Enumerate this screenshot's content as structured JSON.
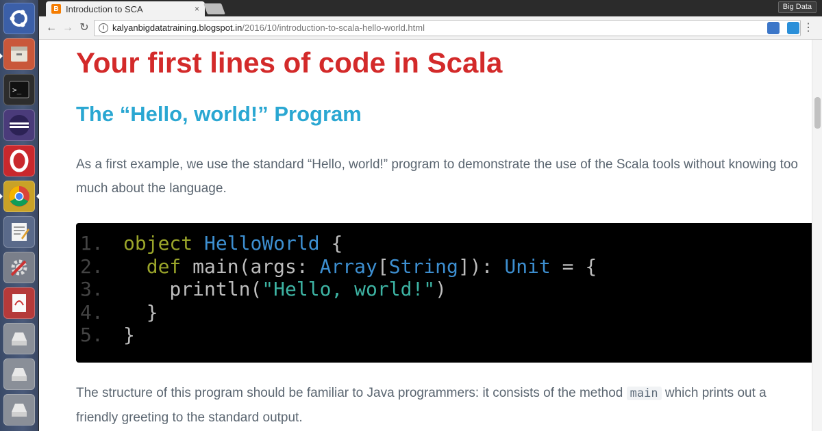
{
  "browser": {
    "tab_title": "Introduction to SCA",
    "tab_close": "×",
    "profile_name": "Big Data",
    "url_host": "kalyanbigdatatraining.blogspot.in",
    "url_path": "/2016/10/introduction-to-scala-hello-world.html",
    "nav": {
      "back": "←",
      "forward": "→",
      "reload": "↻"
    },
    "omni_icons": {
      "zoom": "⊕",
      "star": "☆"
    },
    "menu": "⋮"
  },
  "launcher": {
    "items": [
      "ubuntu-dash-icon",
      "files-icon",
      "terminal-icon",
      "eclipse-icon",
      "opera-icon",
      "chrome-icon",
      "text-editor-icon",
      "settings-icon",
      "document-viewer-icon",
      "drive-icon",
      "drive-icon",
      "drive-icon",
      "drive-icon"
    ],
    "active_index": 5
  },
  "article": {
    "heading": "Your first lines of code in Scala",
    "subheading": "The “Hello, world!” Program",
    "intro": "As a first example, we use the standard “Hello, world!” program to demonstrate the use of the Scala tools without knowing too much about the language.",
    "code_lines": [
      {
        "num": "1.",
        "tokens": [
          {
            "t": "object ",
            "c": "kw"
          },
          {
            "t": "HelloWorld",
            "c": "ty"
          },
          {
            "t": " {",
            "c": "pl"
          }
        ]
      },
      {
        "num": "2.",
        "tokens": [
          {
            "t": "  def ",
            "c": "kw"
          },
          {
            "t": "main(args: ",
            "c": "pl"
          },
          {
            "t": "Array",
            "c": "ty"
          },
          {
            "t": "[",
            "c": "pl"
          },
          {
            "t": "String",
            "c": "ty"
          },
          {
            "t": "]): ",
            "c": "pl"
          },
          {
            "t": "Unit",
            "c": "ty"
          },
          {
            "t": " = {",
            "c": "pl"
          }
        ]
      },
      {
        "num": "3.",
        "tokens": [
          {
            "t": "    println(",
            "c": "pl"
          },
          {
            "t": "\"Hello, world!\"",
            "c": "st"
          },
          {
            "t": ")",
            "c": "pl"
          }
        ]
      },
      {
        "num": "4.",
        "tokens": [
          {
            "t": "  }",
            "c": "pl"
          }
        ]
      },
      {
        "num": "5.",
        "tokens": [
          {
            "t": "}",
            "c": "pl"
          }
        ]
      }
    ],
    "outro_before": "The structure of this program should be familiar to Java programmers: it consists of the method ",
    "outro_code": "main",
    "outro_after": " which prints out a friendly greeting to the standard output."
  }
}
